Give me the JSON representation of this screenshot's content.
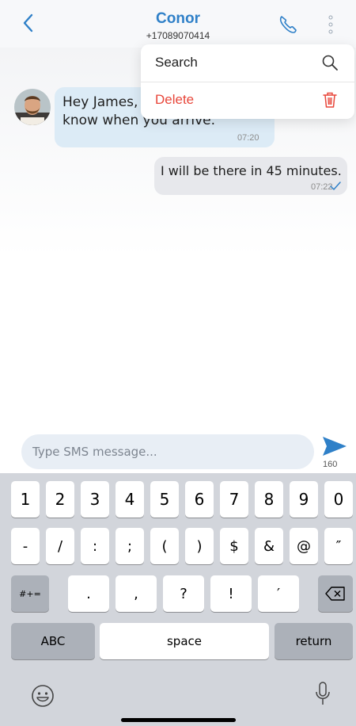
{
  "header": {
    "contact_name": "Conor",
    "contact_number": "+17089070414",
    "back_icon": "chevron-left-icon",
    "call_icon": "phone-icon",
    "more_icon": "vertical-dots-icon",
    "accent_color": "#2f80c8"
  },
  "menu": {
    "items": [
      {
        "label": "Search",
        "icon": "search-icon",
        "color": "#1e1e1e"
      },
      {
        "label": "Delete",
        "icon": "trash-icon",
        "color": "#e8463a"
      }
    ]
  },
  "messages": [
    {
      "direction": "incoming",
      "text": "Hey James, please let me know when you arrive.",
      "time": "07:20"
    },
    {
      "direction": "outgoing",
      "text": "I will be there in 45 minutes.",
      "time": "07:22",
      "status": "sent-check-icon"
    }
  ],
  "composer": {
    "placeholder": "Type SMS message...",
    "char_count": "160",
    "send_icon": "send-icon"
  },
  "keyboard": {
    "row1": [
      "1",
      "2",
      "3",
      "4",
      "5",
      "6",
      "7",
      "8",
      "9",
      "0"
    ],
    "row2": [
      "-",
      "/",
      ":",
      ";",
      "(",
      ")",
      "$",
      "&",
      "@",
      "″"
    ],
    "row3": {
      "switch": "#+=",
      "keys": [
        ".",
        ",",
        "?",
        "!",
        "′"
      ],
      "delete_icon": "backspace-icon"
    },
    "row4": {
      "abc": "ABC",
      "space": "space",
      "return": "return"
    },
    "emoji_icon": "emoji-icon",
    "mic_icon": "microphone-icon"
  }
}
